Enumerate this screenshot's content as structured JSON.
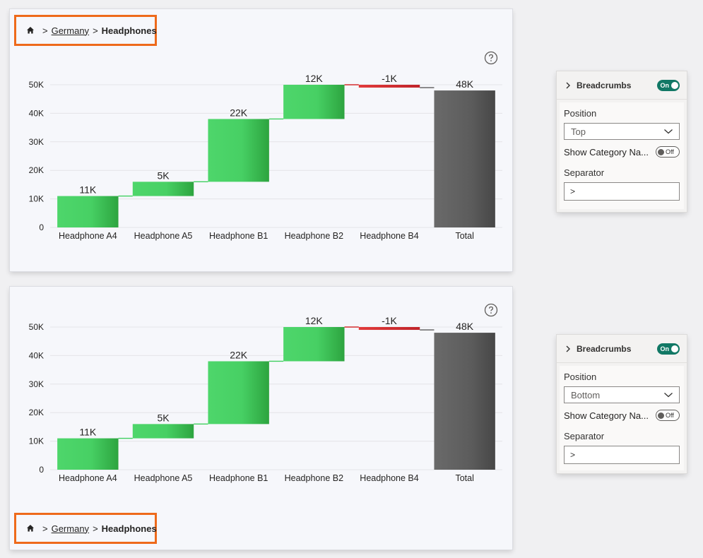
{
  "breadcrumb": {
    "home_icon": "home-icon",
    "separator": ">",
    "items": [
      "Germany",
      "Headphones"
    ]
  },
  "colors": {
    "increase": "#3fcf5f",
    "decrease": "#d32f2f",
    "total": "#5a5a5a",
    "highlight": "#ee6a1b",
    "toggle_on": "#117865"
  },
  "chart_data": [
    {
      "type": "bar",
      "subtype": "waterfall",
      "categories": [
        "Headphone A4",
        "Headphone A5",
        "Headphone B1",
        "Headphone B2",
        "Headphone B4",
        "Total"
      ],
      "values": [
        11000,
        5000,
        22000,
        12000,
        -1000,
        48000
      ],
      "data_labels": [
        "11K",
        "5K",
        "22K",
        "12K",
        "-1K",
        "48K"
      ],
      "is_total": [
        false,
        false,
        false,
        false,
        false,
        true
      ],
      "y_ticks": [
        "0",
        "10K",
        "20K",
        "30K",
        "40K",
        "50K"
      ],
      "ylim": [
        0,
        50000
      ],
      "grid": true
    },
    {
      "type": "bar",
      "subtype": "waterfall",
      "categories": [
        "Headphone A4",
        "Headphone A5",
        "Headphone B1",
        "Headphone B2",
        "Headphone B4",
        "Total"
      ],
      "values": [
        11000,
        5000,
        22000,
        12000,
        -1000,
        48000
      ],
      "data_labels": [
        "11K",
        "5K",
        "22K",
        "12K",
        "-1K",
        "48K"
      ],
      "is_total": [
        false,
        false,
        false,
        false,
        false,
        true
      ],
      "y_ticks": [
        "0",
        "10K",
        "20K",
        "30K",
        "40K",
        "50K"
      ],
      "ylim": [
        0,
        50000
      ],
      "grid": true
    }
  ],
  "panels": [
    {
      "title": "Breadcrumbs",
      "toggle": "On",
      "position_label": "Position",
      "position_value": "Top",
      "show_category_label": "Show Category Na...",
      "show_category_toggle": "Off",
      "separator_label": "Separator",
      "separator_value": ">"
    },
    {
      "title": "Breadcrumbs",
      "toggle": "On",
      "position_label": "Position",
      "position_value": "Bottom",
      "show_category_label": "Show Category Na...",
      "show_category_toggle": "Off",
      "separator_label": "Separator",
      "separator_value": ">"
    }
  ]
}
